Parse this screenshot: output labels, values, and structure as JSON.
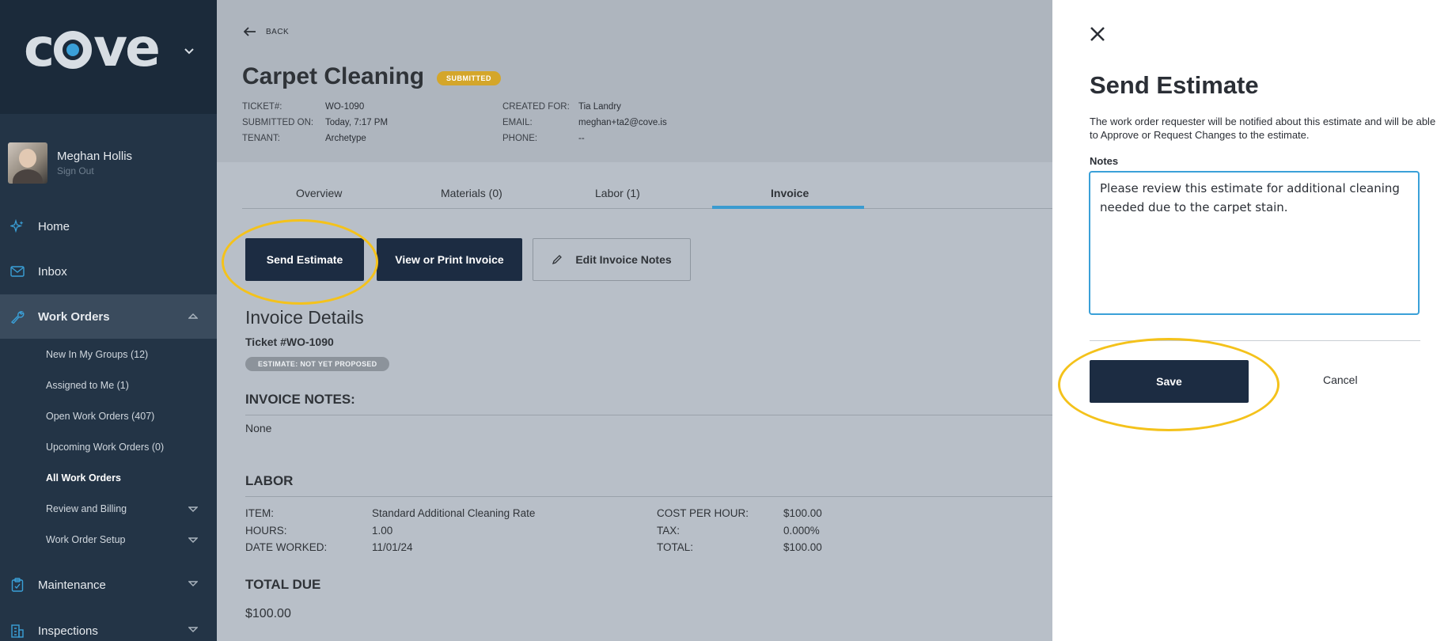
{
  "sidebar": {
    "logo": "cove",
    "user": {
      "name": "Meghan Hollis",
      "signout": "Sign Out"
    },
    "nav": [
      {
        "label": "Home",
        "icon": "sparkle-icon"
      },
      {
        "label": "Inbox",
        "icon": "envelope-icon"
      },
      {
        "label": "Work Orders",
        "icon": "wrench-icon"
      },
      {
        "label": "Maintenance",
        "icon": "clipboard-icon"
      },
      {
        "label": "Inspections",
        "icon": "building-icon"
      }
    ],
    "work_orders_sub": [
      "New In My Groups (12)",
      "Assigned to Me (1)",
      "Open Work Orders (407)",
      "Upcoming Work Orders (0)",
      "All Work Orders",
      "Review and Billing",
      "Work Order Setup"
    ]
  },
  "header": {
    "back": "BACK",
    "title": "Carpet Cleaning",
    "status": "SUBMITTED",
    "meta_left": [
      {
        "k": "TICKET#:",
        "v": "WO-1090"
      },
      {
        "k": "SUBMITTED ON:",
        "v": "Today, 7:17 PM"
      },
      {
        "k": "TENANT:",
        "v": "Archetype"
      }
    ],
    "meta_right": [
      {
        "k": "CREATED FOR:",
        "v": "Tia Landry"
      },
      {
        "k": "EMAIL:",
        "v": "meghan+ta2@cove.is"
      },
      {
        "k": "PHONE:",
        "v": "--"
      }
    ]
  },
  "tabs": [
    "Overview",
    "Materials (0)",
    "Labor (1)",
    "Invoice"
  ],
  "actions": {
    "send_estimate": "Send Estimate",
    "view_print": "View or Print Invoice",
    "edit_notes": "Edit Invoice Notes"
  },
  "invoice": {
    "title": "Invoice Details",
    "ticket": "Ticket #WO-1090",
    "estimate_badge": "ESTIMATE: NOT YET PROPOSED",
    "notes_heading": "INVOICE NOTES:",
    "notes_value": "None",
    "labor_heading": "LABOR",
    "labor_left": [
      {
        "k": "ITEM:",
        "v": "Standard Additional Cleaning Rate"
      },
      {
        "k": "HOURS:",
        "v": "1.00"
      },
      {
        "k": "DATE WORKED:",
        "v": "11/01/24"
      }
    ],
    "labor_right": [
      {
        "k": "COST PER HOUR:",
        "v": "$100.00"
      },
      {
        "k": "TAX:",
        "v": "0.000%"
      },
      {
        "k": "TOTAL:",
        "v": "$100.00"
      }
    ],
    "total_heading": "TOTAL DUE",
    "total_value": "$100.00"
  },
  "panel": {
    "title": "Send Estimate",
    "description": "The work order requester will be notified about this estimate and will be able to Approve or Request Changes to the estimate.",
    "notes_label": "Notes",
    "notes_value": "Please review this estimate for additional cleaning needed due to the carpet stain.",
    "save": "Save",
    "cancel": "Cancel"
  },
  "colors": {
    "accent": "#3aa0d8",
    "navy": "#1c2c42",
    "highlight": "#f4c21b",
    "badge": "#d4a62a"
  }
}
